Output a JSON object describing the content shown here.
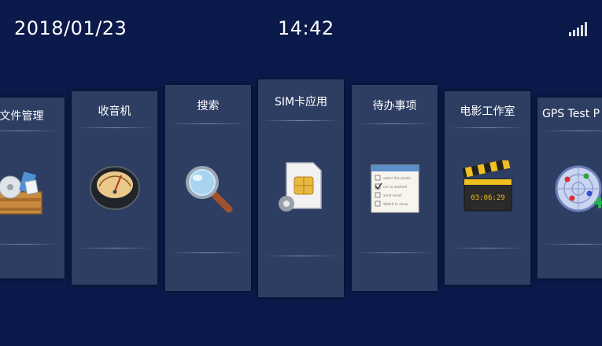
{
  "status_bar": {
    "date": "2018/01/23",
    "time": "14:42",
    "signal_icon": "signal-strength-icon"
  },
  "apps": [
    {
      "label": "文件管理",
      "icon": "file-manager-icon"
    },
    {
      "label": "收音机",
      "icon": "radio-icon"
    },
    {
      "label": "搜索",
      "icon": "search-icon"
    },
    {
      "label": "SIM卡应用",
      "icon": "sim-card-icon"
    },
    {
      "label": "待办事项",
      "icon": "todo-list-icon"
    },
    {
      "label": "电影工作室",
      "icon": "movie-clapper-icon"
    },
    {
      "label": "GPS Test P",
      "icon": "gps-radar-icon"
    }
  ],
  "todo_icon_text": [
    "water the plants",
    "car to washed",
    "send email",
    "Watch tv show"
  ],
  "clapper_text": "03:06:29",
  "colors": {
    "background": "#0b1a4a",
    "card": "#2e3e63",
    "text": "#ffffff"
  }
}
